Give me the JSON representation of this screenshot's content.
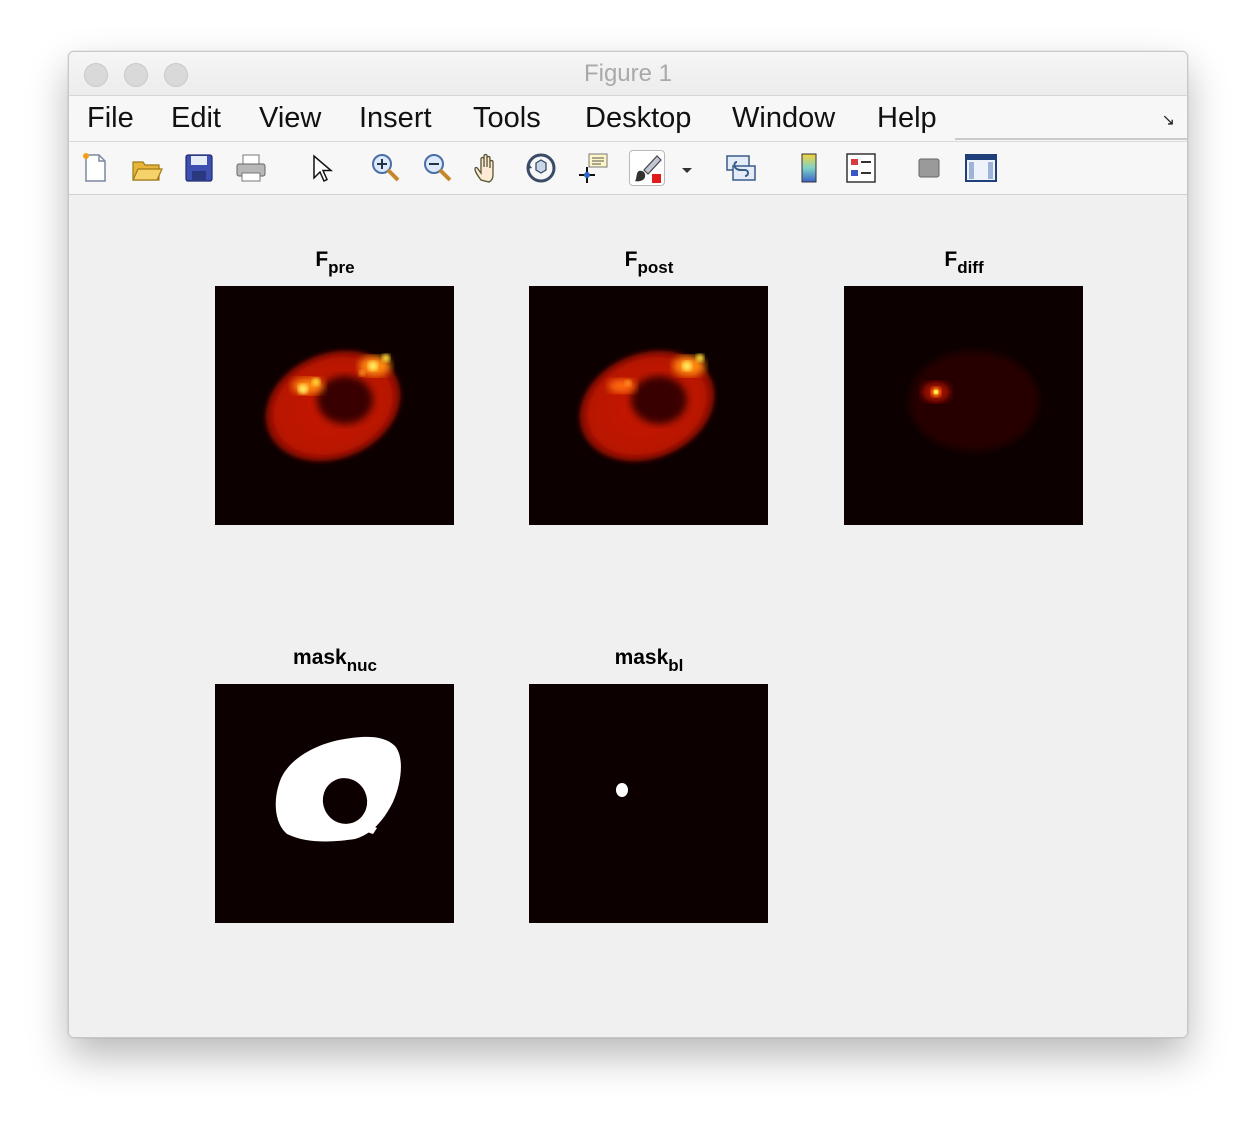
{
  "window": {
    "title": "Figure 1"
  },
  "menu": [
    "File",
    "Edit",
    "View",
    "Insert",
    "Tools",
    "Desktop",
    "Window",
    "Help"
  ],
  "toolbar": {
    "icons": [
      "new-figure-icon",
      "open-file-icon",
      "save-icon",
      "print-icon",
      "pointer-icon",
      "zoom-in-icon",
      "zoom-out-icon",
      "pan-icon",
      "rotate-3d-icon",
      "data-cursor-icon",
      "brush-icon",
      "link-plot-icon",
      "colorbar-icon",
      "legend-icon",
      "hide-plot-tools-icon",
      "show-plot-tools-icon"
    ]
  },
  "plots": [
    {
      "title": "F",
      "sub": "pre"
    },
    {
      "title": "F",
      "sub": "post"
    },
    {
      "title": "F",
      "sub": "diff"
    },
    {
      "title": "mask",
      "sub": "nuc"
    },
    {
      "title": "mask",
      "sub": "bl"
    }
  ],
  "colors": {
    "image_background": "#0c0000",
    "hot_red": "#c81800",
    "hot_yellow": "#ffe84a",
    "mask_white": "#ffffff"
  }
}
